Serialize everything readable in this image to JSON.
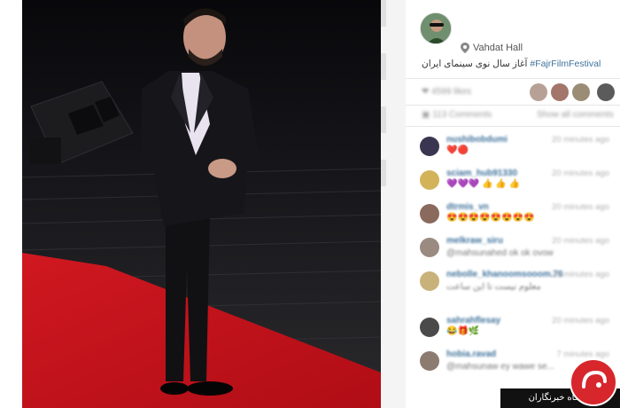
{
  "post": {
    "location": "Vahdat Hall",
    "caption_text": "آغاز سال نوی سینمای ایران",
    "caption_hashtag": "#FajrFilmFestival"
  },
  "stats": {
    "likes": "❤ 4599 likes",
    "comments": "▣ 113 Comments",
    "show_all": "Show all comments"
  },
  "comments": [
    {
      "user": "nushibobdumi",
      "time": "20 minutes ago",
      "text": "",
      "emoji": "❤️🔴"
    },
    {
      "user": "sciam_hub91330",
      "time": "20 minutes ago",
      "text": "",
      "emoji": "💜💜💜 👍 👍 👍"
    },
    {
      "user": "dtrmis_vn",
      "time": "20 minutes ago",
      "text": "",
      "emoji": "😍😍😍😍😍😍😍😍"
    },
    {
      "user": "melkraw_siru",
      "time": "20 minutes ago",
      "text": "@mahsunahed ok ok ovow",
      "emoji": ""
    },
    {
      "user": "nebolle_khanoomsooom.76",
      "time": "20 minutes ago",
      "text": "معلوم نیست تا این ساعت",
      "emoji": ""
    },
    {
      "user": "sahrahflesay",
      "time": "20 minutes ago",
      "text": "",
      "emoji": "😂🎁🌿"
    },
    {
      "user": "hobia.ravad",
      "time": "7 minutes ago",
      "text": "@mahsunaw ey wawe se...",
      "emoji": ""
    }
  ],
  "watermark": {
    "text": "باشگاه خبرنگاران"
  },
  "colors": {
    "hashtag": "#3f729b",
    "carpet": "#c8121c",
    "watermark_red": "#d7262c"
  }
}
